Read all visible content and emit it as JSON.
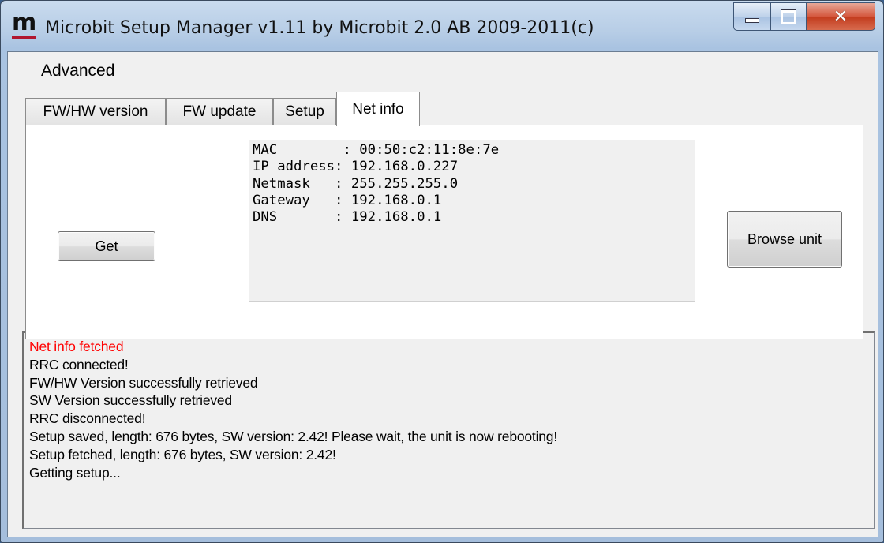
{
  "window": {
    "title": "Microbit Setup Manager v1.11 by Microbit 2.0 AB 2009-2011(c)",
    "icon": "m-logo-icon",
    "controls": [
      "minimize-icon",
      "maximize-icon",
      "close-icon"
    ]
  },
  "menu": {
    "items": [
      {
        "label": "Advanced"
      }
    ]
  },
  "tabs": [
    {
      "label": "FW/HW version",
      "active": false
    },
    {
      "label": "FW update",
      "active": false
    },
    {
      "label": "Setup",
      "active": false
    },
    {
      "label": "Net info",
      "active": true
    }
  ],
  "netinfo": {
    "get_button": "Get",
    "browse_button": "Browse unit",
    "lines": [
      "MAC        : 00:50:c2:11:8e:7e",
      "IP address: 192.168.0.227",
      "Netmask   : 255.255.255.0",
      "Gateway   : 192.168.0.1",
      "DNS       : 192.168.0.1"
    ]
  },
  "log": {
    "lines": [
      "Net info fetched",
      "RRC connected!",
      "FW/HW Version successfully retrieved",
      "SW Version successfully retrieved",
      "RRC disconnected!",
      "Setup saved, length: 676 bytes, SW version: 2.42! Please wait, the unit is now rebooting!",
      "Setup fetched, length: 676 bytes, SW version: 2.42!",
      "Getting setup..."
    ],
    "highlight_color": "#ff0000"
  }
}
